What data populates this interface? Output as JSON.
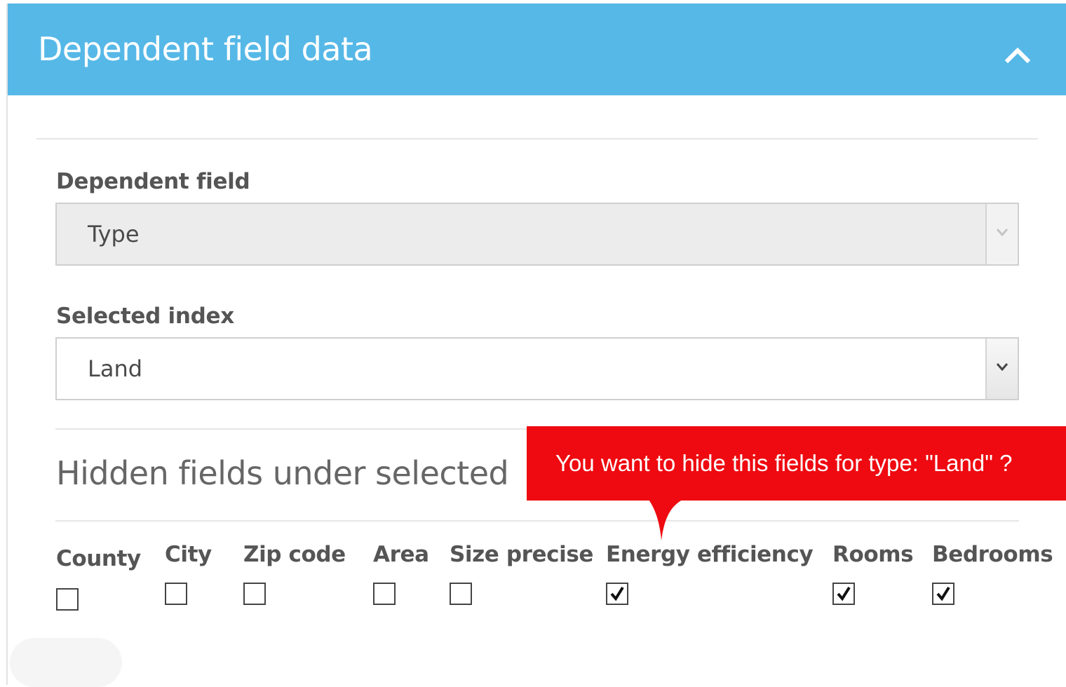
{
  "panel": {
    "title": "Dependent field data",
    "collapse_icon": "chevron-up-icon",
    "header_color": "#56b8e7"
  },
  "dependent_field": {
    "label": "Dependent field",
    "value": "Type",
    "disabled": true
  },
  "selected_index": {
    "label": "Selected index",
    "value": "Land"
  },
  "hidden_fields": {
    "heading": "Hidden fields under selected",
    "tooltip": "You want to hide this fields for type: \"Land\" ?",
    "tooltip_color": "#ee0a10",
    "fields": [
      {
        "label": "County",
        "checked": false
      },
      {
        "label": "City",
        "checked": false
      },
      {
        "label": "Zip code",
        "checked": false
      },
      {
        "label": "Area",
        "checked": false
      },
      {
        "label": "Size precise",
        "checked": false
      },
      {
        "label": "Energy efficiency",
        "checked": true
      },
      {
        "label": "Rooms",
        "checked": true
      },
      {
        "label": "Bedrooms",
        "checked": true
      }
    ]
  }
}
